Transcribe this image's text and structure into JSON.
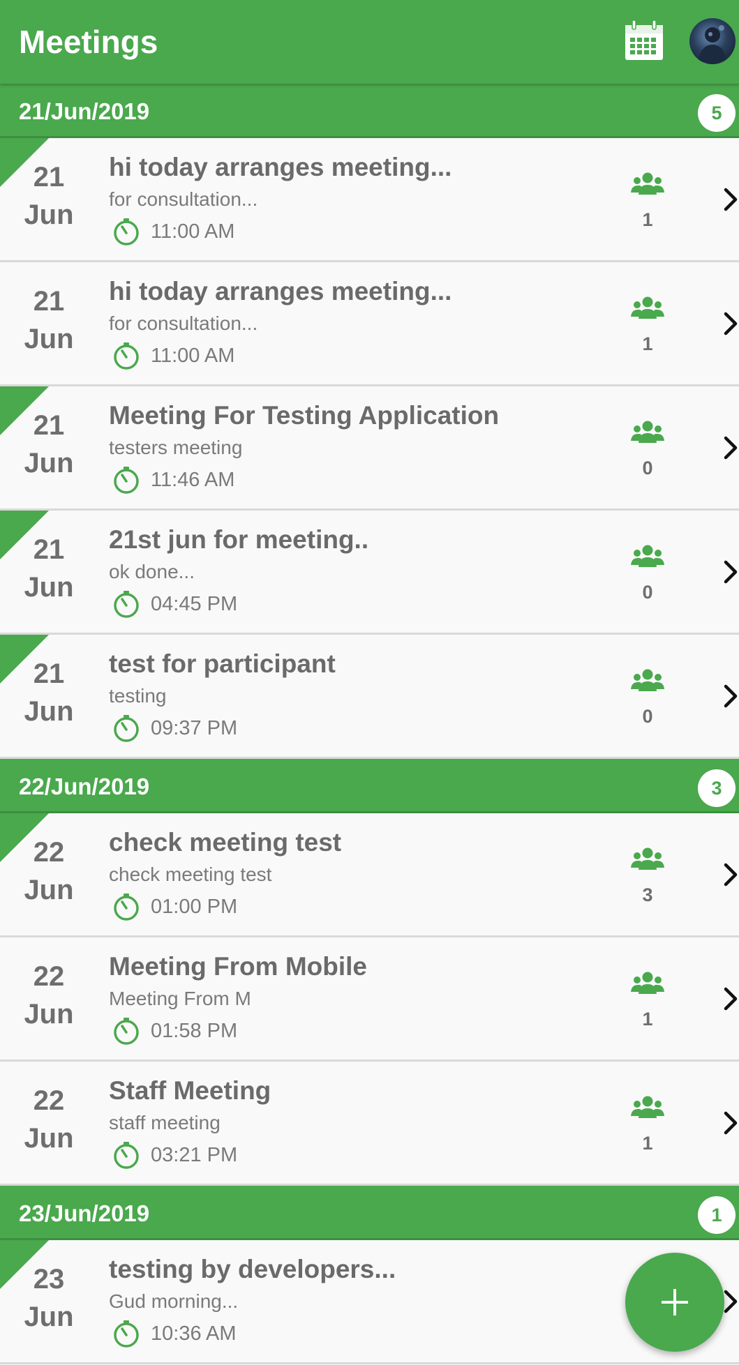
{
  "app_bar": {
    "title": "Meetings"
  },
  "colors": {
    "primary": "#4aa84d",
    "text_gray": "#6e6e6e"
  },
  "icons": {
    "calendar": "calendar-icon",
    "profile": "avatar",
    "attendees": "people-icon",
    "time": "clock-icon",
    "open": "chevron-right-icon",
    "add": "plus-icon"
  },
  "groups": [
    {
      "date": "21/Jun/2019",
      "count": "5",
      "items": [
        {
          "day": "21",
          "month": "Jun",
          "title": "hi today arranges meeting...",
          "subtitle": "for consultation...",
          "time": "11:00 AM",
          "participants": "1",
          "marked": true
        },
        {
          "day": "21",
          "month": "Jun",
          "title": "hi today arranges meeting...",
          "subtitle": "for consultation...",
          "time": "11:00 AM",
          "participants": "1",
          "marked": false
        },
        {
          "day": "21",
          "month": "Jun",
          "title": "Meeting For Testing Application",
          "subtitle": "testers meeting",
          "time": "11:46 AM",
          "participants": "0",
          "marked": true
        },
        {
          "day": "21",
          "month": "Jun",
          "title": "21st jun for meeting..",
          "subtitle": "ok done...",
          "time": "04:45 PM",
          "participants": "0",
          "marked": true
        },
        {
          "day": "21",
          "month": "Jun",
          "title": "test for participant",
          "subtitle": "testing",
          "time": "09:37 PM",
          "participants": "0",
          "marked": true
        }
      ]
    },
    {
      "date": "22/Jun/2019",
      "count": "3",
      "items": [
        {
          "day": "22",
          "month": "Jun",
          "title": "check meeting test",
          "subtitle": "check meeting test",
          "time": "01:00 PM",
          "participants": "3",
          "marked": true
        },
        {
          "day": "22",
          "month": "Jun",
          "title": "Meeting From Mobile",
          "subtitle": "Meeting From M",
          "time": "01:58 PM",
          "participants": "1",
          "marked": false
        },
        {
          "day": "22",
          "month": "Jun",
          "title": "Staff Meeting",
          "subtitle": "staff meeting",
          "time": "03:21 PM",
          "participants": "1",
          "marked": false
        }
      ]
    },
    {
      "date": "23/Jun/2019",
      "count": "1",
      "items": [
        {
          "day": "23",
          "month": "Jun",
          "title": "testing by developers...",
          "subtitle": "Gud morning...",
          "time": "10:36 AM",
          "participants": "",
          "marked": true
        }
      ]
    }
  ]
}
